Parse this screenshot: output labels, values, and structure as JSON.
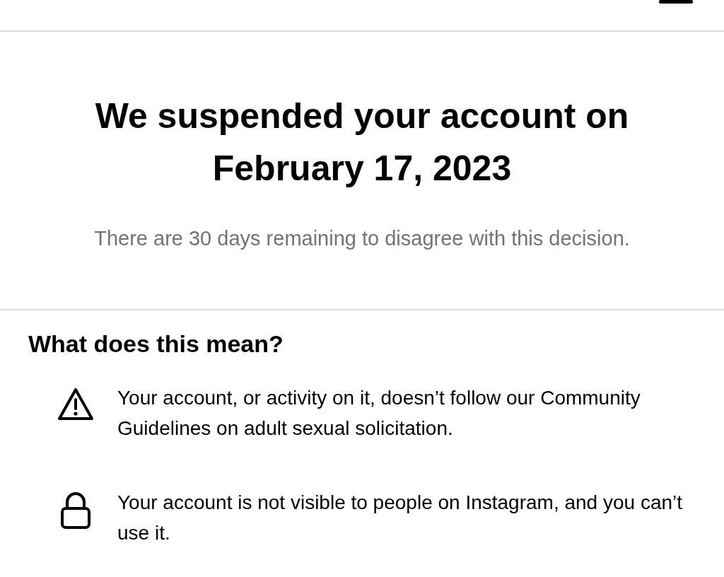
{
  "title": "We suspended your account on February 17, 2023",
  "subtitle": "There are 30 days remaining to disagree with this decision.",
  "section": {
    "heading": "What does this mean?",
    "items": [
      {
        "kind": "warning",
        "text": "Your account, or activity on it, doesn’t follow our Community Guidelines on adult sexual solicitation."
      },
      {
        "kind": "lock",
        "text": "Your account is not visible to people on Instagram, and you can’t use it."
      }
    ]
  }
}
